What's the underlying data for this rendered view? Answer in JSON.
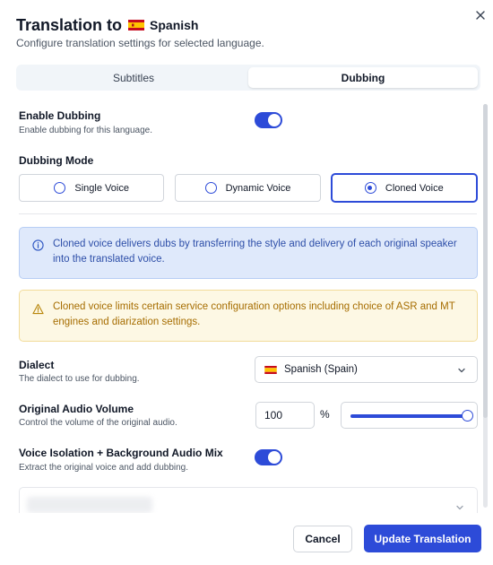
{
  "dialog": {
    "title": "Translation to",
    "language": "Spanish",
    "language_flag": "spain-flag",
    "subtitle": "Configure translation settings for selected language.",
    "close_icon": "close-icon"
  },
  "tabs": [
    {
      "label": "Subtitles",
      "active": false
    },
    {
      "label": "Dubbing",
      "active": true
    }
  ],
  "enable_dubbing": {
    "label": "Enable Dubbing",
    "help": "Enable dubbing for this language.",
    "enabled": true
  },
  "dubbing_mode": {
    "label": "Dubbing Mode",
    "options": [
      "Single Voice",
      "Dynamic Voice",
      "Cloned Voice"
    ],
    "selected": "Cloned Voice"
  },
  "info_notice": {
    "icon": "info-icon",
    "text": "Cloned voice delivers dubs by transferring the style and delivery of each original speaker into the translated voice."
  },
  "warning_notice": {
    "icon": "warning-icon",
    "text": "Cloned voice limits certain service configuration options including choice of ASR and MT engines and diarization settings."
  },
  "dialect": {
    "label": "Dialect",
    "help": "The dialect to use for dubbing.",
    "value": "Spanish (Spain)",
    "flag": "spain-flag"
  },
  "original_audio_volume": {
    "label": "Original Audio Volume",
    "help": "Control the volume of the original audio.",
    "value": "100",
    "unit": "%",
    "slider_fraction": 1.0
  },
  "voice_isolation": {
    "label": "Voice Isolation + Background Audio Mix",
    "help": "Extract the original voice and add dubbing.",
    "enabled": true
  },
  "footer": {
    "cancel_label": "Cancel",
    "update_label": "Update Translation"
  },
  "colors": {
    "accent": "#2d4bd8",
    "info_bg": "#dfe9fb",
    "info_text": "#2d4ea8",
    "warning_bg": "#fdf8e4",
    "warning_text": "#a66d00"
  }
}
